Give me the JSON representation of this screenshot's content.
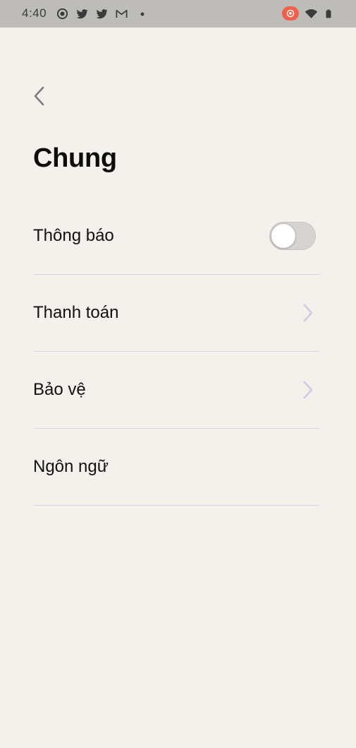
{
  "status_bar": {
    "time": "4:40",
    "left_icons": [
      "radio-button-icon",
      "twitter-icon",
      "twitter-icon",
      "gmail-icon",
      "dot-icon"
    ],
    "right_icons": [
      "cast-badge-icon",
      "wifi-icon",
      "battery-icon"
    ],
    "badge_color": "#f0614d"
  },
  "header": {
    "back_icon": "chevron-left-icon",
    "title": "Chung"
  },
  "settings": {
    "items": [
      {
        "label": "Thông báo",
        "control": "toggle",
        "toggle_on": false
      },
      {
        "label": "Thanh toán",
        "control": "chevron"
      },
      {
        "label": "Bảo vệ",
        "control": "chevron"
      },
      {
        "label": "Ngôn ngữ",
        "control": "none"
      }
    ]
  },
  "colors": {
    "background": "#f4f1ec",
    "status_bar": "#bdbcb8",
    "divider": "#d9d4e8",
    "chevron": "#cfc9e6"
  }
}
